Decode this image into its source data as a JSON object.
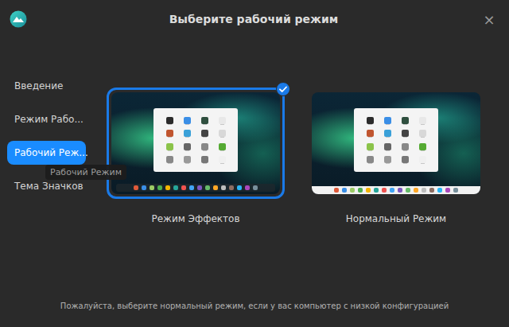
{
  "window": {
    "title": "Выберите рабочий режим",
    "close": "×"
  },
  "sidebar": {
    "items": [
      {
        "label": "Введение",
        "selected": false
      },
      {
        "label": "Режим Рабо...",
        "selected": false
      },
      {
        "label": "Рабочий Реж...",
        "selected": true
      },
      {
        "label": "Тема Значков",
        "selected": false
      }
    ],
    "tooltip": "Рабочий Режим"
  },
  "modes": [
    {
      "label": "Режим Эффектов",
      "kind": "effects",
      "selected": true
    },
    {
      "label": "Нормальный Режим",
      "kind": "normal",
      "selected": false
    }
  ],
  "launcher_icons": [
    "#2b2b2b",
    "#3a8ee6",
    "#2f4f3f",
    "#e8e8e8",
    "#c0552f",
    "#3aa0d8",
    "#444444",
    "#d8d8d8",
    "#8bc34a",
    "#666666",
    "#888888",
    "#55aa33",
    "#888888",
    "#999999",
    "#777777",
    "#f0f0f0"
  ],
  "dock_icons": [
    "#e05a3a",
    "#3a8ee6",
    "#9ccc65",
    "#4caf50",
    "#f4b400",
    "#26a69a",
    "#ef5350",
    "#42a5f5",
    "#7e57c2",
    "#66bb6a",
    "#ffa726",
    "#bdbdbd",
    "#8d6e63",
    "#29b6f6",
    "#ab47bc",
    "#78909c"
  ],
  "footer": "Пожалуйста, выберите нормальный режим, если у вас компьютер с низкой конфигурацией"
}
